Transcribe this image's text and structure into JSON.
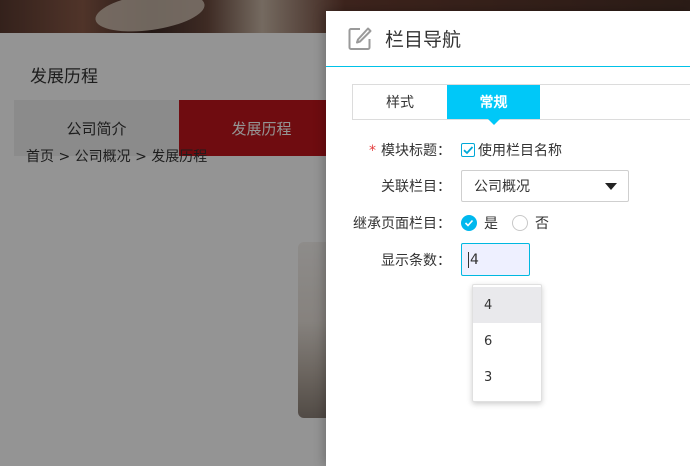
{
  "background": {
    "section_title": "发展历程",
    "tabs": [
      {
        "label": "公司简介"
      },
      {
        "label": "发展历程"
      }
    ],
    "breadcrumb": "首页 > 公司概况 > 发展历程"
  },
  "dialog": {
    "title": "栏目导航",
    "title_icon": "edit-icon",
    "tabs": [
      {
        "label": "样式",
        "active": false
      },
      {
        "label": "常规",
        "active": true
      }
    ],
    "form": {
      "module_title": {
        "required_mark": "*",
        "label": "模块标题：",
        "checkbox_label": "使用栏目名称",
        "checked": true
      },
      "related_column": {
        "label": "关联栏目：",
        "value": "公司概况"
      },
      "inherit_page": {
        "label": "继承页面栏目：",
        "options": [
          "是",
          "否"
        ],
        "selected": "是"
      },
      "display_count": {
        "label": "显示条数：",
        "value": "4",
        "dropdown_options": [
          "4",
          "6",
          "3"
        ],
        "highlighted": "4"
      }
    }
  },
  "colors": {
    "accent": "#00c8f8",
    "brand_red": "#c0161c",
    "required": "#e43c3c"
  }
}
